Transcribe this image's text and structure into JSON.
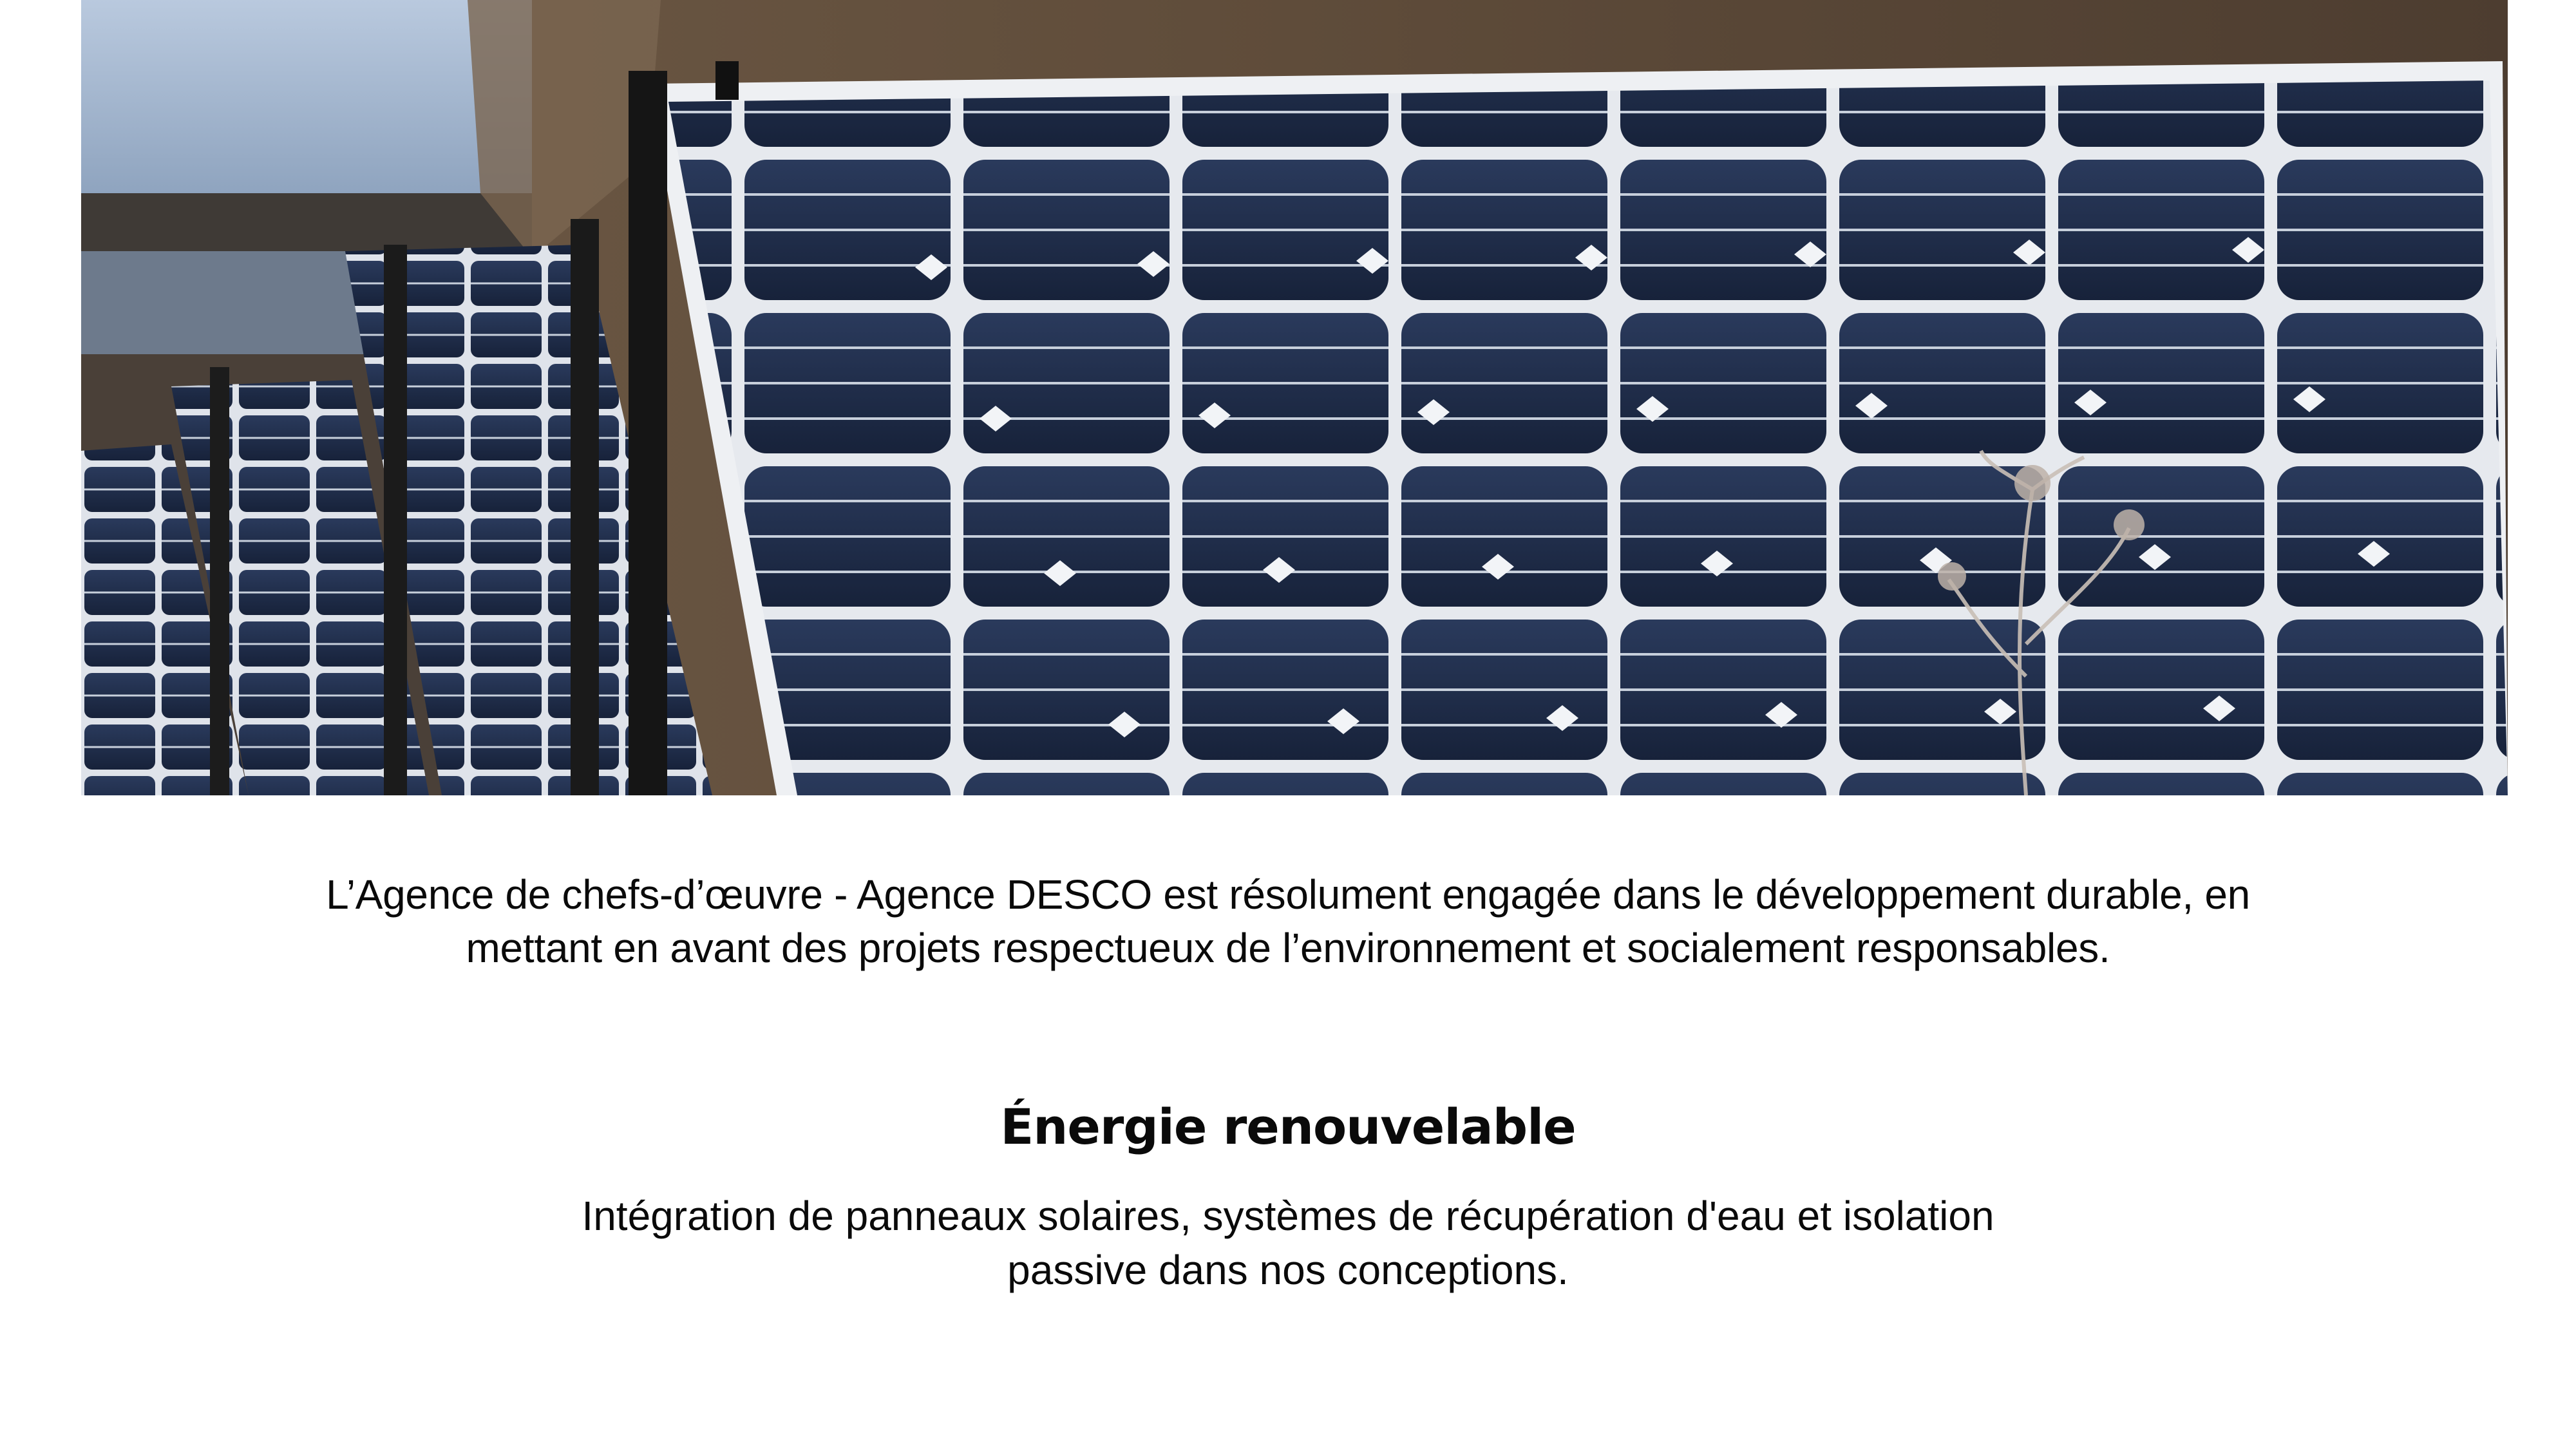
{
  "hero_image": {
    "icon": "solar-panels-photo"
  },
  "intro": {
    "text": "L’Agence de chefs-d’œuvre - Agence DESCO est résolument engagée dans le développement durable, en mettant en avant des projets respectueux de l’environnement et socialement responsables."
  },
  "feature": {
    "title": "Énergie renouvelable",
    "description": "Intégration de panneaux solaires, systèmes de récupération d'eau et isolation passive dans nos conceptions."
  },
  "colors": {
    "text": "#0a0a0a",
    "background": "#ffffff",
    "panel_cell": "#1f2d4a",
    "panel_frame": "#e8eaee"
  }
}
